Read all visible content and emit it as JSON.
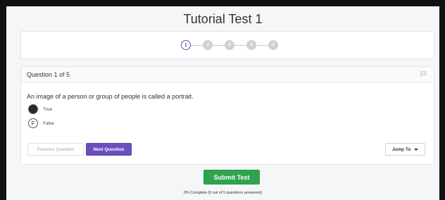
{
  "test": {
    "title": "Tutorial Test 1"
  },
  "steps": [
    {
      "label": "1",
      "state": "active"
    },
    {
      "label": "2",
      "state": "todo"
    },
    {
      "label": "3",
      "state": "todo"
    },
    {
      "label": "4",
      "state": "todo"
    },
    {
      "label": "5",
      "state": "todo"
    }
  ],
  "question": {
    "header": "Question 1 of 5",
    "flag_icon": "flag-icon",
    "text": "An image of a person or group of people is called a portrait.",
    "options": [
      {
        "label": "True",
        "selected": true,
        "glyph": ""
      },
      {
        "label": "False",
        "selected": false,
        "glyph": "F"
      }
    ]
  },
  "nav": {
    "previous_label": "Previous Question",
    "next_label": "Next Question",
    "jump_label": "Jump To"
  },
  "submit": {
    "label": "Submit Test"
  },
  "progress": {
    "text": "0% Complete (0 out of 5 questions answered)",
    "percent": 0,
    "answered": 0,
    "total": 5
  },
  "colors": {
    "accent": "#6b50bd",
    "submit": "#2ea44f",
    "frame": "#111111"
  }
}
